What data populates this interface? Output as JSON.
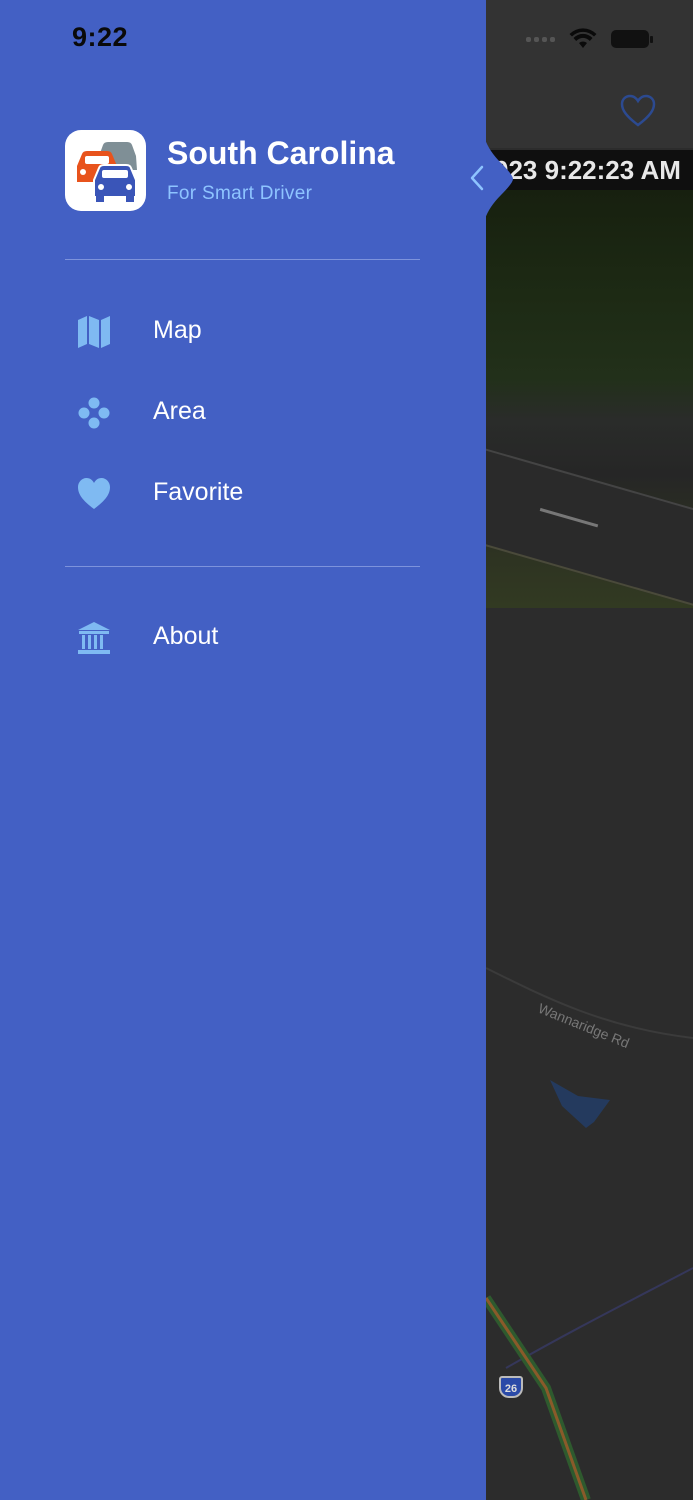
{
  "status_bar": {
    "time": "9:22"
  },
  "drawer": {
    "app_name": "South Carolina",
    "app_tagline": "For Smart Driver",
    "menu": [
      {
        "label": "Map",
        "icon": "map-icon"
      },
      {
        "label": "Area",
        "icon": "area-dots-icon"
      },
      {
        "label": "Favorite",
        "icon": "heart-icon"
      }
    ],
    "secondary_menu": [
      {
        "label": "About",
        "icon": "bank-building-icon"
      }
    ]
  },
  "background_screen": {
    "camera_timestamp": "023 9:22:23 AM",
    "map_road_label": "Wannaridge Rd",
    "highway_shield": "26"
  },
  "colors": {
    "drawer_bg": "#4360c4",
    "accent_light_blue": "#8ec4ff",
    "icon_blue": "#7fbaf2"
  }
}
